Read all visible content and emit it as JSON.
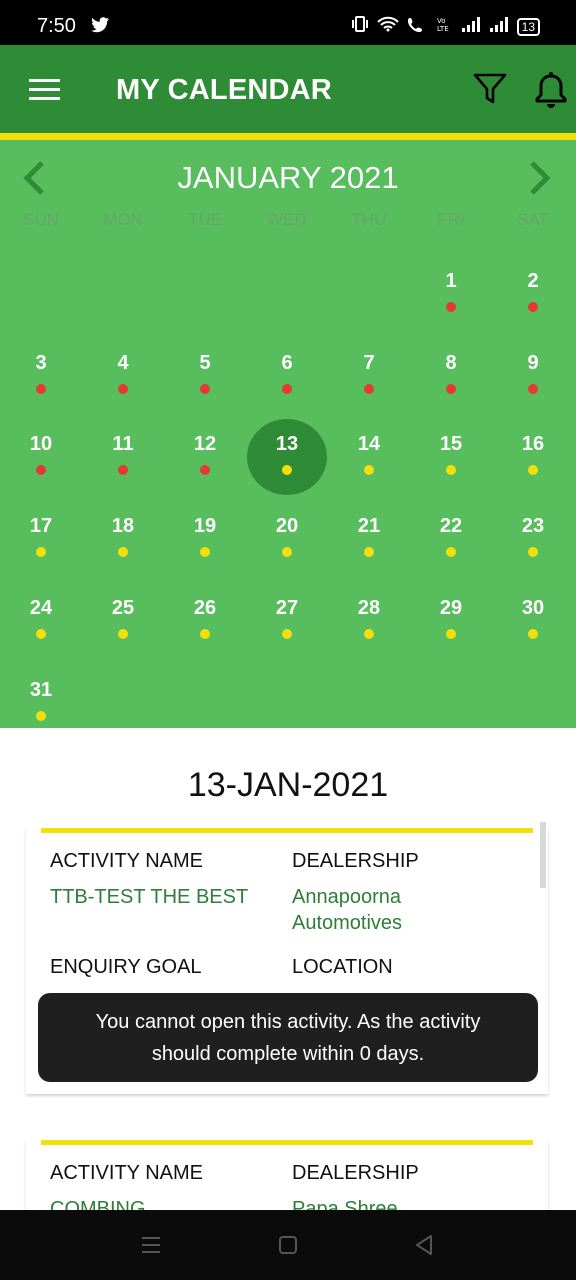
{
  "status": {
    "time": "7:50",
    "battery": "13"
  },
  "appbar": {
    "title": "MY CALENDAR"
  },
  "calendar": {
    "month_label": "JANUARY 2021",
    "weekdays": [
      "SUN",
      "MON",
      "TUE",
      "WED",
      "THU",
      "FRI",
      "SAT"
    ],
    "selected_day": "13",
    "colors": {
      "past_dot": "#e53935",
      "future_dot": "#f5df0b",
      "green": "#57bd5d",
      "dark_green": "#2e8b36"
    },
    "days": [
      {
        "label": "1",
        "dot": "past"
      },
      {
        "label": "2",
        "dot": "past"
      },
      {
        "label": "3",
        "dot": "past"
      },
      {
        "label": "4",
        "dot": "past"
      },
      {
        "label": "5",
        "dot": "past"
      },
      {
        "label": "6",
        "dot": "past"
      },
      {
        "label": "7",
        "dot": "past"
      },
      {
        "label": "8",
        "dot": "past"
      },
      {
        "label": "9",
        "dot": "past"
      },
      {
        "label": "10",
        "dot": "past"
      },
      {
        "label": "11",
        "dot": "past"
      },
      {
        "label": "12",
        "dot": "past"
      },
      {
        "label": "13",
        "dot": "future"
      },
      {
        "label": "14",
        "dot": "future"
      },
      {
        "label": "15",
        "dot": "future"
      },
      {
        "label": "16",
        "dot": "future"
      },
      {
        "label": "17",
        "dot": "future"
      },
      {
        "label": "18",
        "dot": "future"
      },
      {
        "label": "19",
        "dot": "future"
      },
      {
        "label": "20",
        "dot": "future"
      },
      {
        "label": "21",
        "dot": "future"
      },
      {
        "label": "22",
        "dot": "future"
      },
      {
        "label": "23",
        "dot": "future"
      },
      {
        "label": "24",
        "dot": "future"
      },
      {
        "label": "25",
        "dot": "future"
      },
      {
        "label": "26",
        "dot": "future"
      },
      {
        "label": "27",
        "dot": "future"
      },
      {
        "label": "28",
        "dot": "future"
      },
      {
        "label": "29",
        "dot": "future"
      },
      {
        "label": "30",
        "dot": "future"
      },
      {
        "label": "31",
        "dot": "future"
      }
    ]
  },
  "selected_date": "13-JAN-2021",
  "cards": [
    {
      "activity_name_label": "ACTIVITY NAME",
      "activity_name": "TTB-TEST THE BEST",
      "dealership_label": "DEALERSHIP",
      "dealership_line1": "Annapoorna",
      "dealership_line2": "Automotives",
      "enquiry_goal_label": "ENQUIRY GOAL",
      "location_label": "LOCATION"
    },
    {
      "activity_name_label": "ACTIVITY NAME",
      "activity_name": "COMBING",
      "dealership_label": "DEALERSHIP",
      "dealership_line1": "Papa Shree"
    }
  ],
  "toast": {
    "line1": "You cannot open this activity. As the activity",
    "line2": "should  complete within 0 days."
  }
}
